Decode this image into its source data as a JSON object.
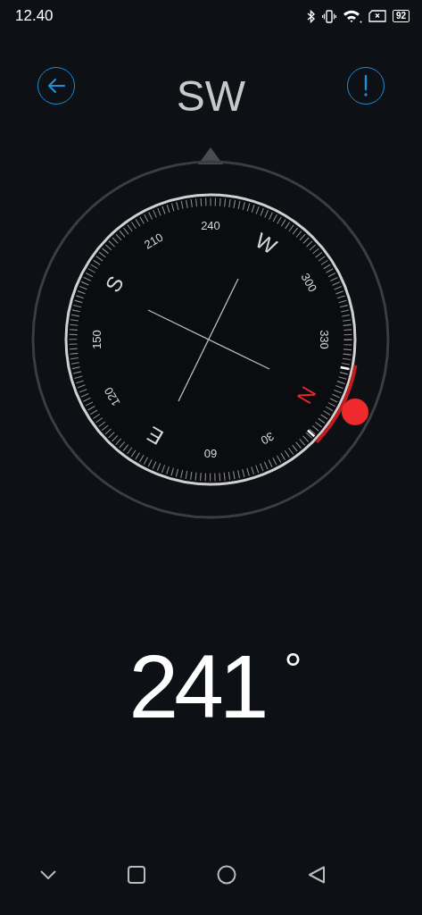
{
  "status_bar": {
    "time": "12.40",
    "battery": "92"
  },
  "header": {
    "direction": "SW"
  },
  "dial": {
    "labels": [
      {
        "text": "N",
        "kind": "cardinal",
        "color": "#e0282a"
      },
      {
        "text": "30",
        "kind": "number",
        "color": "#d8d8d8"
      },
      {
        "text": "60",
        "kind": "number",
        "color": "#d8d8d8"
      },
      {
        "text": "E",
        "kind": "cardinal",
        "color": "#d8d8d8"
      },
      {
        "text": "120",
        "kind": "number",
        "color": "#d8d8d8"
      },
      {
        "text": "150",
        "kind": "number",
        "color": "#d8d8d8"
      },
      {
        "text": "S",
        "kind": "cardinal",
        "color": "#d8d8d8"
      },
      {
        "text": "210",
        "kind": "number",
        "color": "#d8d8d8"
      },
      {
        "text": "240",
        "kind": "number",
        "color": "#d8d8d8"
      },
      {
        "text": "W",
        "kind": "cardinal",
        "color": "#d8d8d8"
      },
      {
        "text": "300",
        "kind": "number",
        "color": "#d8d8d8"
      },
      {
        "text": "330",
        "kind": "number",
        "color": "#d8d8d8"
      }
    ]
  },
  "reading": {
    "value": "241",
    "unit": "°"
  }
}
